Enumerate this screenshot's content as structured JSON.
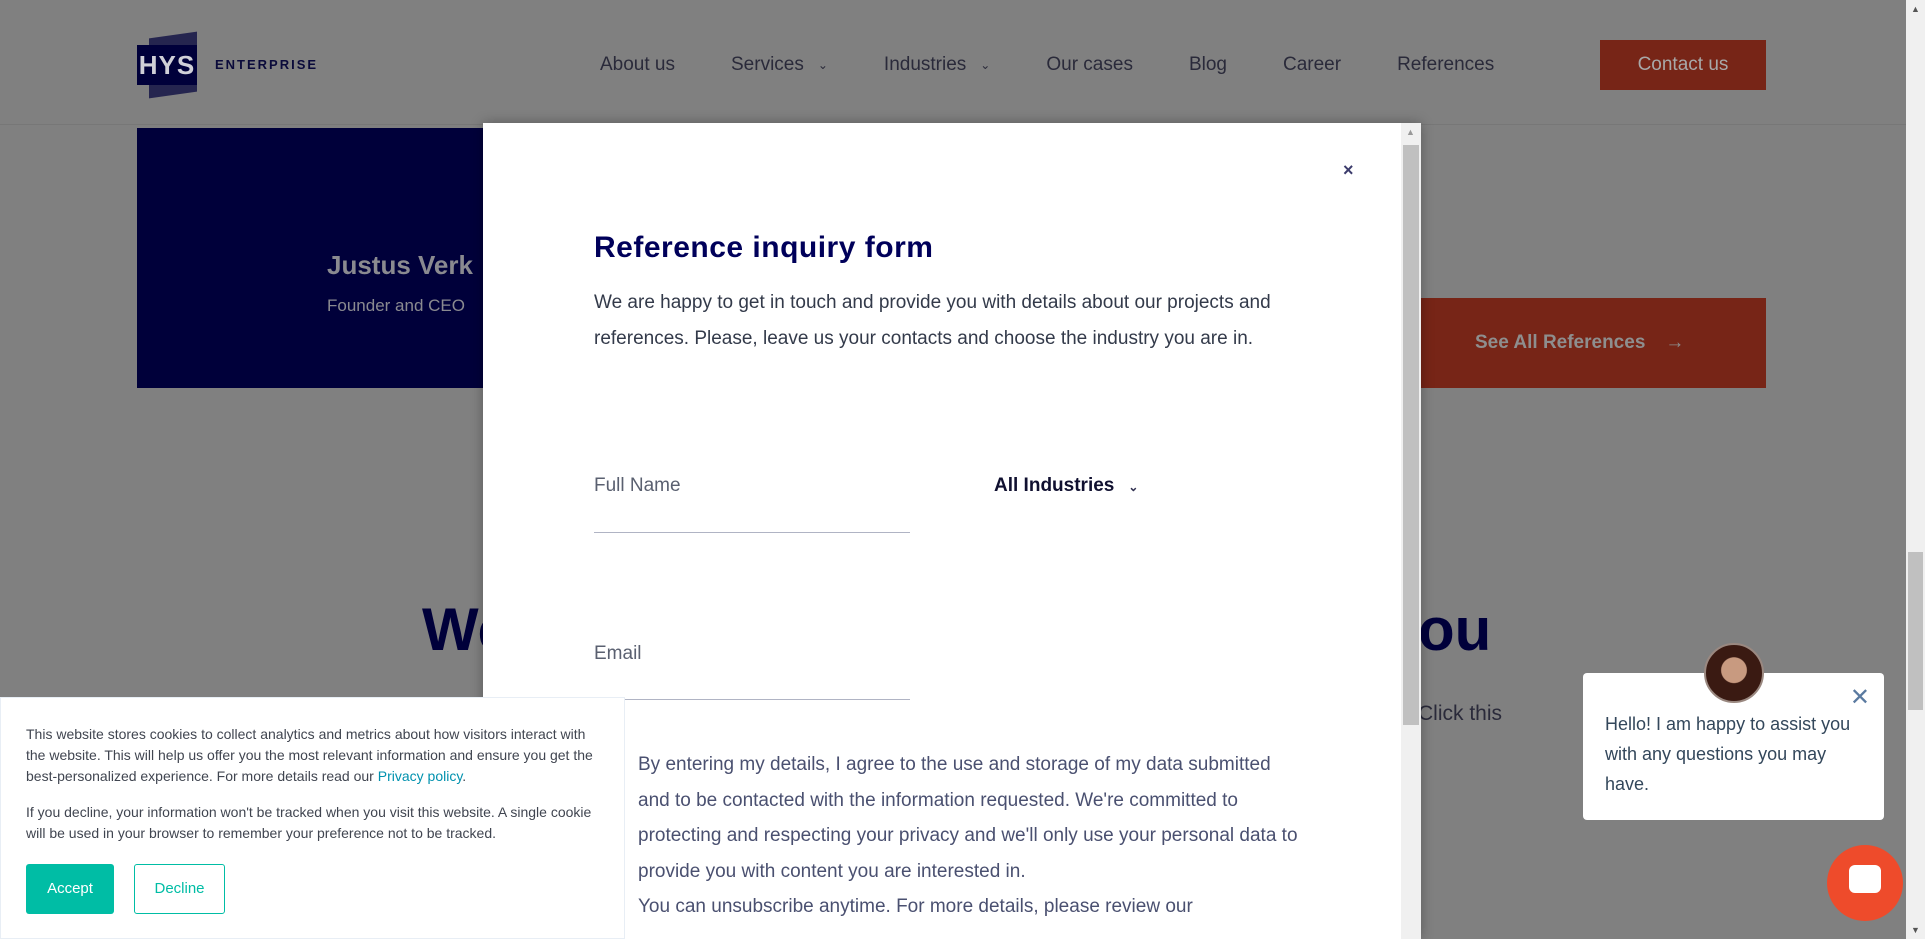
{
  "header": {
    "logo_mark": "HYS",
    "logo_text": "ENTERPRISE",
    "nav": [
      {
        "label": "About us"
      },
      {
        "label": "Services",
        "dropdown": true
      },
      {
        "label": "Industries",
        "dropdown": true
      },
      {
        "label": "Our cases"
      },
      {
        "label": "Blog"
      },
      {
        "label": "Career"
      },
      {
        "label": "References"
      }
    ],
    "contact_label": "Contact us"
  },
  "background": {
    "person_name": "Justus Verk",
    "person_role": "Founder and CEO",
    "see_all_label": "See All References",
    "heading_left": "We",
    "heading_right": "ou",
    "click_text": "Click this"
  },
  "modal": {
    "close": "×",
    "title": "Reference inquiry form",
    "intro": "We are happy to get in touch and provide you with details about our projects and references. Please, leave us your contacts and choose the industry you are in.",
    "full_name_placeholder": "Full Name",
    "industry_select": "All Industries",
    "email_placeholder": "Email",
    "consent": "By entering my details, I agree to the use and storage of my data submitted and to be contacted with the information requested. We're committed to protecting and respecting your privacy and we'll only use your personal data to provide you with content you are interested in.",
    "consent_cut": "You can unsubscribe anytime. For more details, please review our"
  },
  "cookie": {
    "text1": "This website stores cookies to collect analytics and metrics about how visitors interact with the website. This will help us offer you the most relevant information and ensure you get the best-personalized experience. For more details read our ",
    "privacy_link": "Privacy policy",
    "text1_end": ".",
    "text2": "If you decline, your information won't be tracked when you visit this website. A single cookie will be used in your browser to remember your preference not to be tracked.",
    "accept": "Accept",
    "decline": "Decline"
  },
  "chat": {
    "message": "Hello! I am happy to assist you with any questions you may have.",
    "close": "✕"
  },
  "colors": {
    "accent": "#ee4b2b",
    "navy": "#00003a",
    "teal": "#00bda5"
  }
}
